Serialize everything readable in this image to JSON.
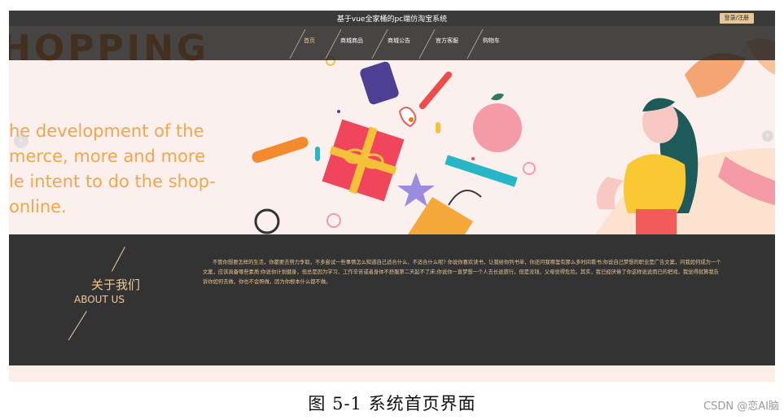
{
  "header": {
    "site_title": "基于vue全家桶的pc端仿淘宝系统",
    "login_label": "登录/注册"
  },
  "nav": {
    "items": [
      {
        "label": "首页",
        "active": true
      },
      {
        "label": "商城商品",
        "active": false
      },
      {
        "label": "商城公告",
        "active": false
      },
      {
        "label": "官方客服",
        "active": false
      },
      {
        "label": "购物车",
        "active": false
      }
    ]
  },
  "banner": {
    "headline": "HOPPING",
    "lines": [
      "he development of the",
      "merce, more and more",
      "le intent to do the shop-",
      "online."
    ],
    "prev_icon": "chevron-left-icon",
    "next_icon": "chevron-right-icon"
  },
  "about": {
    "title_cn": "关于我们",
    "title_en": "ABOUT US",
    "text": "不管你想要怎样的生活，你都要去努力争取，不多尝试一些事情怎么知道自己适合什么、不适合什么呢? 你说你喜欢读书，让我给你列书单，你还问我哪里有那么多时间看书;你说自己梦想的职业是广告文案，问我如何成为一个文案，应该具备哪些素质;你说你计划健身，但总是因为学习、工作辛苦或者身体不舒服第二天起不了床;你说你一直梦想一个人去长途旅行，但是没钱，父母觉得危险。其实，我已经厌倦了你这样说说而已的把戏，我觉得就算我告诉你如何去做，你也不会照做，因为你根本什么都不做。"
  },
  "caption": "图 5-1 系统首页界面",
  "watermark": "CSDN @恋AI脑",
  "colors": {
    "accent": "#f0c991",
    "dark_bg": "#333333",
    "banner_text": "#f2a54a"
  }
}
